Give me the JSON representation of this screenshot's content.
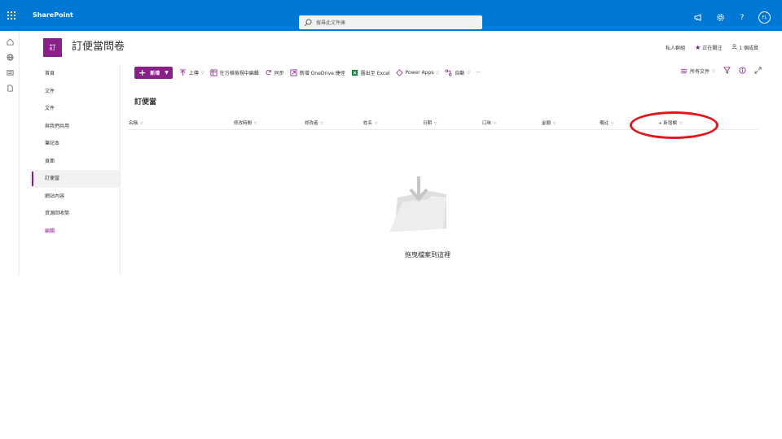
{
  "suite": {
    "brand": "SharePoint",
    "search_placeholder": "搜尋此文件庫",
    "avatar_initials": "FL",
    "icons": [
      "waffle-icon",
      "megaphone-icon",
      "gear-icon",
      "help-icon"
    ]
  },
  "rail": {
    "icons": [
      "home-icon",
      "globe-icon",
      "news-icon",
      "page-icon"
    ]
  },
  "site": {
    "logo_text": "訂",
    "title": "訂便當問卷",
    "private_group": "私人群組",
    "following": "正在關注",
    "members": "1 個成員"
  },
  "nav": {
    "items": [
      {
        "label": "首頁"
      },
      {
        "label": "文件"
      },
      {
        "label": "文件"
      },
      {
        "label": "與我們共用"
      },
      {
        "label": "筆記本"
      },
      {
        "label": "頁面"
      },
      {
        "label": "訂便當"
      },
      {
        "label": "網站內容"
      },
      {
        "label": "資源回收筒"
      },
      {
        "label": "編輯"
      }
    ],
    "active_index": 6
  },
  "commands": {
    "new_label": "新增",
    "upload": "上傳",
    "grid_edit": "在方格檢視中編輯",
    "sync": "同步",
    "onedrive_shortcut": "新增 OneDrive 捷徑",
    "export_excel": "匯出至 Excel",
    "power_apps": "Power Apps",
    "automate": "自動",
    "more": "···",
    "view_label": "所有文件"
  },
  "library": {
    "title": "訂便當",
    "columns": [
      "名稱",
      "修改時間",
      "修改者",
      "姓名",
      "日期",
      "口味",
      "金額",
      "備註",
      "+ 新增欄"
    ],
    "empty_text": "拖曳檔案到這裡"
  },
  "colors": {
    "suite_blue": "#0078d4",
    "brand_purple": "#8a1f8a",
    "highlight_red": "#e5141b"
  }
}
